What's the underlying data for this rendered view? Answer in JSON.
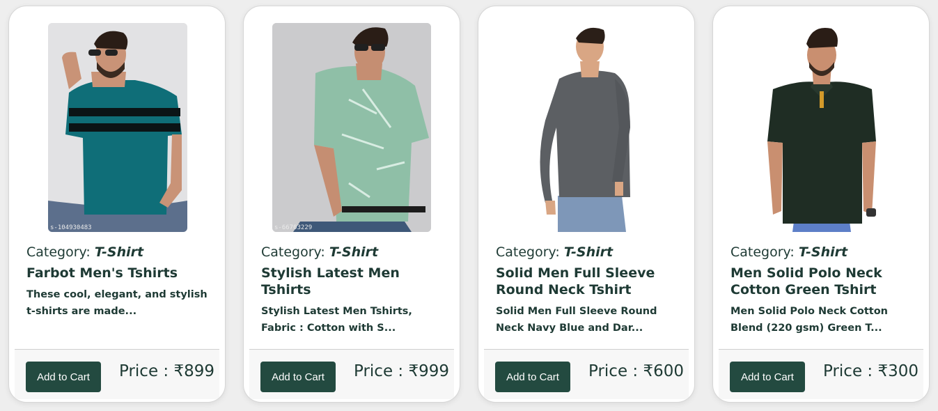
{
  "products": [
    {
      "category_label": "Category: ",
      "category_value": "T-Shirt",
      "title": "Farbot Men's Tshirts",
      "description": "These cool, elegant, and stylish t-shirts are made...",
      "image_code": "s-104930483",
      "button_label": "Add to Cart",
      "price": "Price : ₹899",
      "shirt_color": "#0f6e78"
    },
    {
      "category_label": "Category: ",
      "category_value": "T-Shirt",
      "title": "Stylish Latest Men Tshirts",
      "description": "Stylish Latest Men Tshirts, Fabric : Cotton with S...",
      "image_code": "s-66703229",
      "button_label": "Add to Cart",
      "price": "Price : ₹999",
      "shirt_color": "#8fbfa7"
    },
    {
      "category_label": "Category: ",
      "category_value": "T-Shirt",
      "title": "Solid Men Full Sleeve Round Neck Tshirt",
      "description": "Solid Men Full Sleeve Round Neck Navy Blue and Dar...",
      "image_code": "",
      "button_label": "Add to Cart",
      "price": "Price : ₹600",
      "shirt_color": "#5c5f63"
    },
    {
      "category_label": "Category: ",
      "category_value": "T-Shirt",
      "title": "Men Solid Polo Neck Cotton Green Tshirt",
      "description": "Men Solid Polo Neck Cotton Blend (220 gsm) Green T...",
      "image_code": "",
      "button_label": "Add to Cart",
      "price": "Price : ₹300",
      "shirt_color": "#1f2d24"
    }
  ],
  "colors": {
    "text": "#1e3a34",
    "button": "#234a40",
    "card_bg": "#ffffff",
    "page_bg": "#eeeeee"
  }
}
